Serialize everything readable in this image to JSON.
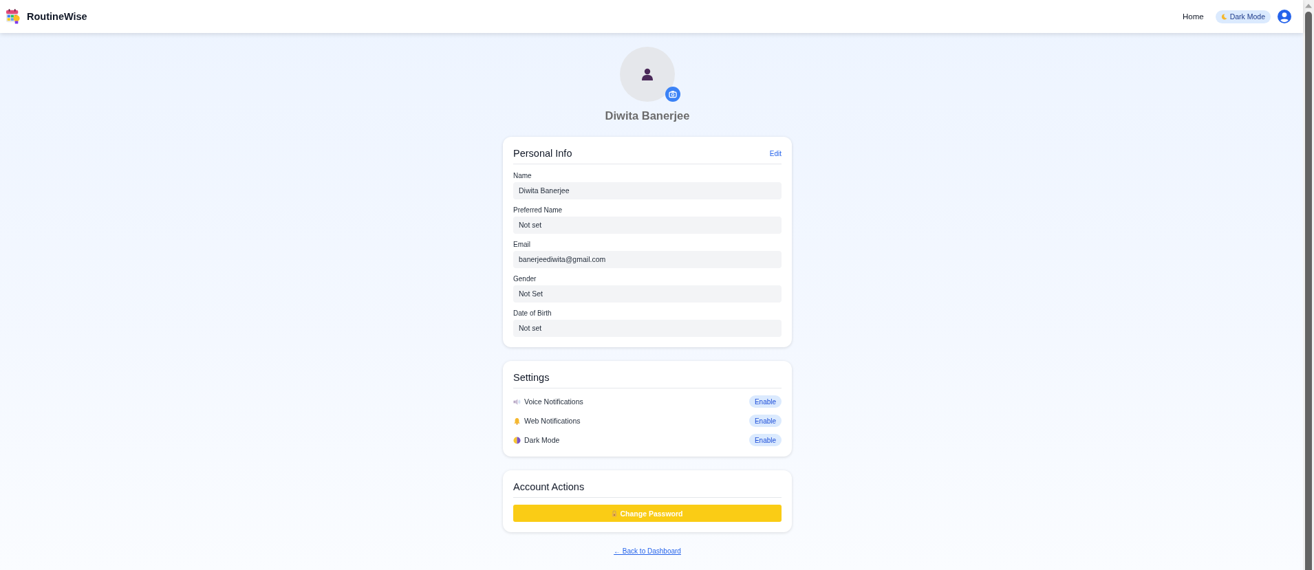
{
  "top_bar": {
    "brand": "RoutineWise",
    "nav_link": "Home",
    "theme_button": "Dark Mode"
  },
  "profile": {
    "name": "Diwita Banerjee"
  },
  "personal_info": {
    "title": "Personal Info",
    "edit": "Edit",
    "fields": [
      {
        "label": "Name",
        "value": "Diwita Banerjee"
      },
      {
        "label": "Preferred Name",
        "value": "Not set"
      },
      {
        "label": "Email",
        "value": "banerjeediwita@gmail.com"
      },
      {
        "label": "Gender",
        "value": "Not Set"
      },
      {
        "label": "Date of Birth",
        "value": "Not set"
      }
    ]
  },
  "settings": {
    "title": "Settings",
    "items": [
      {
        "label": "Voice Notifications",
        "action": "Enable"
      },
      {
        "label": "Web Notifications",
        "action": "Enable"
      },
      {
        "label": "Dark Mode",
        "action": "Enable"
      }
    ]
  },
  "account_actions": {
    "title": "Account Actions",
    "buttons": [
      {
        "label": "Change Password"
      }
    ]
  },
  "back_link": "← Back to Dashboard"
}
